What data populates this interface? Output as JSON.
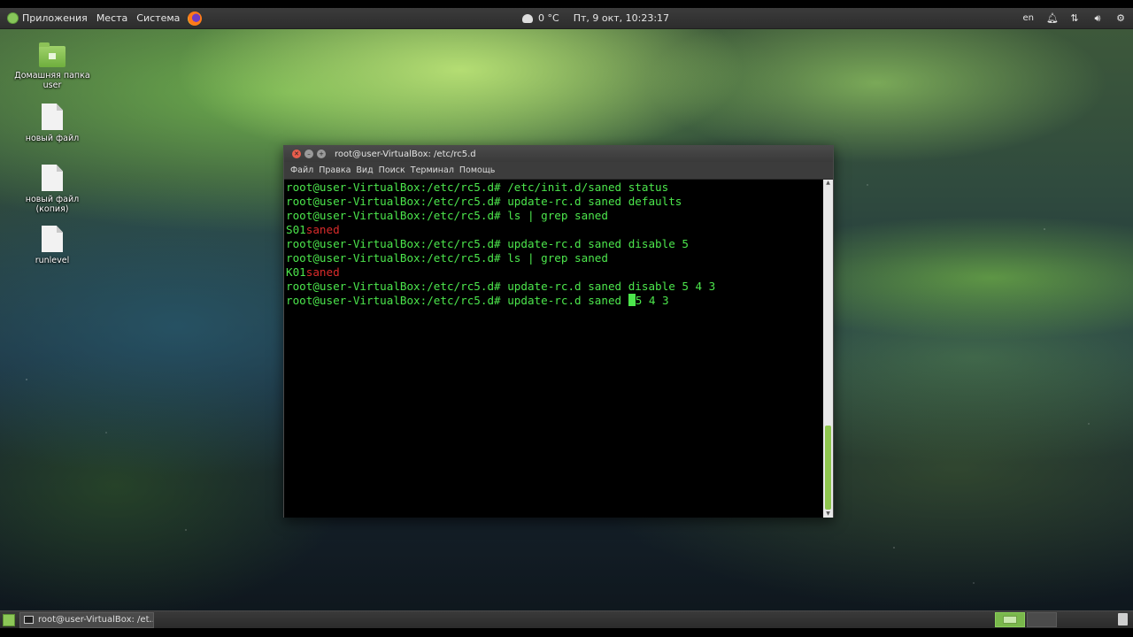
{
  "top_panel": {
    "menu": [
      "Приложения",
      "Места",
      "Система"
    ],
    "weather": "0 °C",
    "datetime": "Пт, 9 окт, 10:23:17",
    "keyboard_layout": "en"
  },
  "desktop_icons": [
    {
      "label": "Домашняя папка user",
      "type": "folder"
    },
    {
      "label": "новый файл",
      "type": "file"
    },
    {
      "label": "новый файл (копия)",
      "type": "file"
    },
    {
      "label": "runlevel",
      "type": "file"
    }
  ],
  "terminal": {
    "title": "root@user-VirtualBox: /etc/rc5.d",
    "menu": [
      "Файл",
      "Правка",
      "Вид",
      "Поиск",
      "Терминал",
      "Помощь"
    ],
    "lines": [
      {
        "prompt": "root@user-VirtualBox:/etc/rc5.d#",
        "cmd": " /etc/init.d/saned status"
      },
      {
        "prompt": "root@user-VirtualBox:/etc/rc5.d#",
        "cmd": " update-rc.d saned defaults"
      },
      {
        "prompt": "root@user-VirtualBox:/etc/rc5.d#",
        "cmd": " ls | grep saned"
      },
      {
        "prefix": "S01",
        "red": "saned"
      },
      {
        "prompt": "root@user-VirtualBox:/etc/rc5.d#",
        "cmd": " update-rc.d saned disable 5"
      },
      {
        "prompt": "root@user-VirtualBox:/etc/rc5.d#",
        "cmd": " ls | grep saned"
      },
      {
        "prefix": "K01",
        "red": "saned"
      },
      {
        "prompt": "root@user-VirtualBox:/etc/rc5.d#",
        "cmd": " update-rc.d saned disable 5 4 3"
      }
    ],
    "current": {
      "prompt": "root@user-VirtualBox:/etc/rc5.d#",
      "before_cursor": " update-rc.d saned ",
      "after_cursor": "5 4 3"
    }
  },
  "taskbar": {
    "task_label": "root@user-VirtualBox: /et..."
  },
  "colors": {
    "terminal_text": "#4ce64c",
    "terminal_error": "#d92b2b",
    "accent": "#8cc657"
  }
}
